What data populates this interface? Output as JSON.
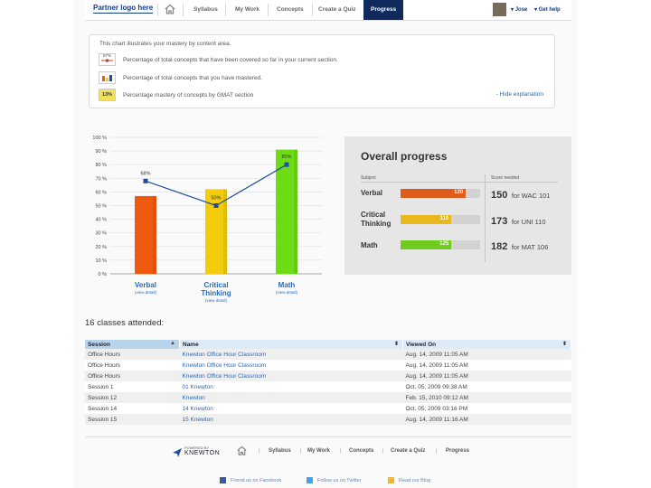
{
  "nav": {
    "logo": "Partner logo here",
    "items": [
      "Syllabus",
      "My Work",
      "Concepts",
      "Create a Quiz",
      "Progress"
    ],
    "active": "Progress",
    "user": "Jose",
    "help": "Get help"
  },
  "info": {
    "intro": "This chart illustrates your mastery by content area.",
    "legend": [
      {
        "icon": "coverage-line-icon",
        "badge": "67%",
        "text": "Percentage of total concepts that have been covered so far in your current section."
      },
      {
        "icon": "mastery-bars-icon",
        "badge": "",
        "text": "Percentage of total concepts that you have mastered."
      },
      {
        "icon": "gmat-section-icon",
        "badge": "13%",
        "text": "Percentage mastery of concepts by GMAT section"
      }
    ],
    "hide_link": "- Hide explanation"
  },
  "chart_data": {
    "type": "bar",
    "categories": [
      "Verbal",
      "Critical Thinking",
      "Math"
    ],
    "category_lines": [
      [
        "Verbal"
      ],
      [
        "Critical",
        "Thinking"
      ],
      [
        "Math"
      ]
    ],
    "detail_label": "(view detail)",
    "series": [
      {
        "values": [
          57,
          62,
          91
        ],
        "colors": [
          "#f05a10",
          "#f3cd0c",
          "#6edb17"
        ]
      },
      {
        "values": [
          68,
          50,
          80
        ],
        "color": "#1f4e9c",
        "labels": [
          "68%",
          "50%",
          "80%"
        ]
      }
    ],
    "ylim": [
      0,
      100
    ],
    "yticks": [
      "0 %",
      "10 %",
      "20 %",
      "30 %",
      "40 %",
      "50 %",
      "60 %",
      "70 %",
      "80 %",
      "90 %",
      "100 %"
    ],
    "grid": true
  },
  "overall": {
    "title": "Overall progress",
    "subject_header": "Subject",
    "score_header": "Score needed",
    "rows": [
      {
        "subject": "Verbal",
        "value": "120",
        "fraction": 0.82,
        "color": "#e05a1a",
        "score": "150",
        "target": "for WAC 101"
      },
      {
        "subject": "Critical Thinking",
        "value": "110",
        "fraction": 0.64,
        "color": "#e8b81c",
        "score": "173",
        "target": "for UNI 110"
      },
      {
        "subject": "Math",
        "value": "125",
        "fraction": 0.64,
        "color": "#6fcc1e",
        "score": "182",
        "target": "for MAT 106"
      }
    ]
  },
  "classes": {
    "title": "16 classes attended:",
    "headers": [
      "Session",
      "Name",
      "Viewed On"
    ],
    "rows": [
      [
        "Office Hours",
        "Knewton Office Hour Classroom",
        "Aug. 14, 2009 11:05 AM"
      ],
      [
        "Office Hours",
        "Knewton Office Hour Classroom",
        "Aug. 14, 2009 11:05 AM"
      ],
      [
        "Office Hours",
        "Knewton Office Hour Classroom",
        "Aug. 14, 2009 11:05 AM"
      ],
      [
        "Session 1",
        "01 Knewton",
        "Oct. 05, 2009 09:38 AM"
      ],
      [
        "Session 12",
        "Knewton",
        "Feb. 15, 2010 09:12 AM"
      ],
      [
        "Session 14",
        "14 Knewton",
        "Oct. 05, 2009 03:16 PM"
      ],
      [
        "Session 15",
        "15 Knewton",
        "Aug. 14, 2009 11:16 AM"
      ]
    ]
  },
  "footer": {
    "powered": "POWERED BY",
    "brand": "KNEWTON",
    "items": [
      "Syllabus",
      "My Work",
      "Concepts",
      "Create a Quiz",
      "Progress"
    ],
    "social": [
      "Friend us on Facebook",
      "Follow us on Twitter",
      "Read our Blog"
    ]
  }
}
